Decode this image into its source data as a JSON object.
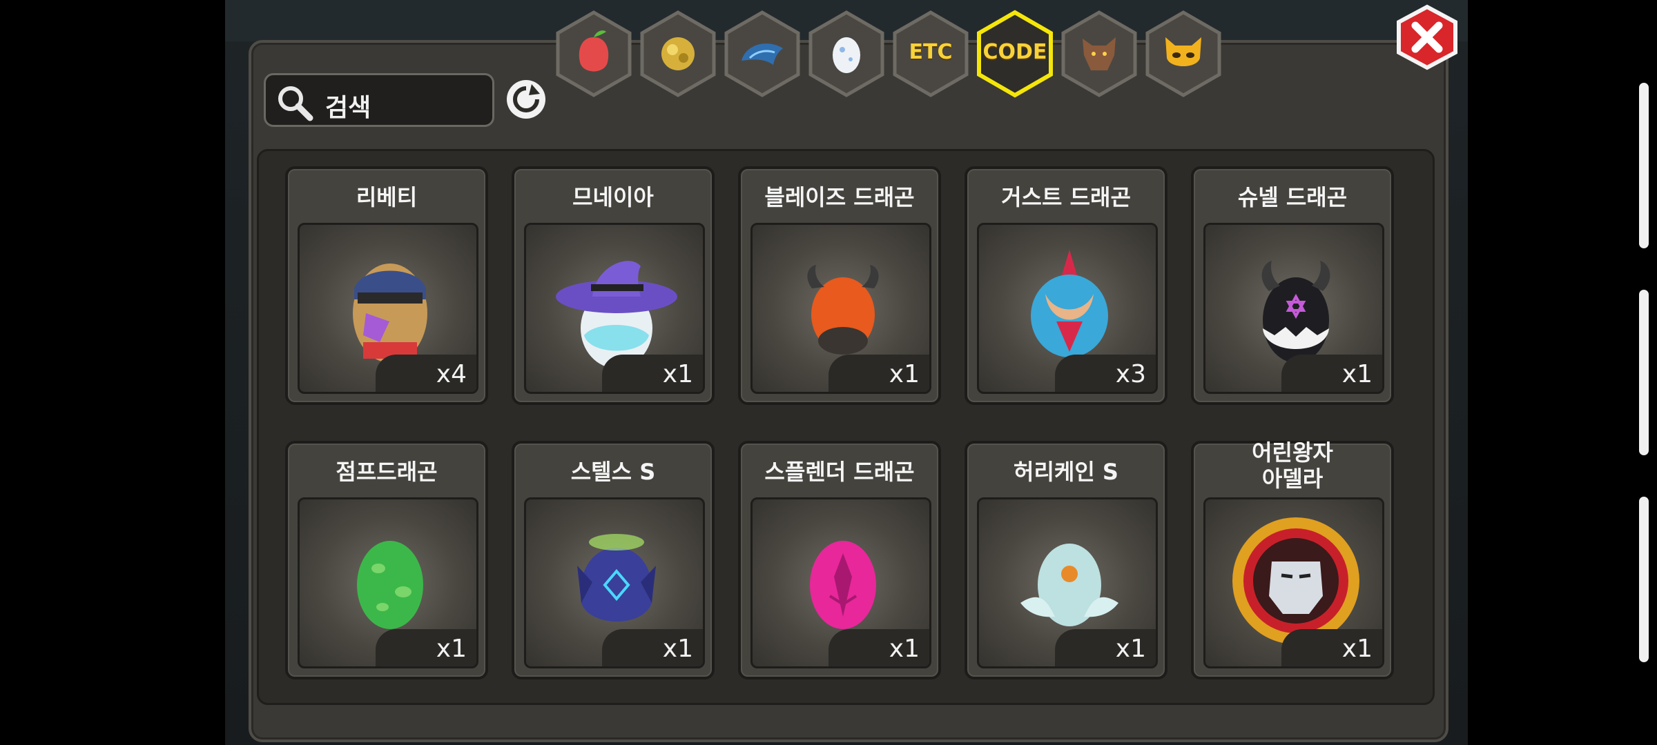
{
  "search": {
    "placeholder": "검색"
  },
  "tabs": [
    {
      "icon": "fruit-icon",
      "label": ""
    },
    {
      "icon": "gold-ore-icon",
      "label": ""
    },
    {
      "icon": "dragon-scale-icon",
      "label": ""
    },
    {
      "icon": "egg-icon",
      "label": ""
    },
    {
      "icon": "etc-icon",
      "label": "ETC"
    },
    {
      "icon": "code-icon",
      "label": "CODE",
      "selected": true
    },
    {
      "icon": "wolf-icon",
      "label": ""
    },
    {
      "icon": "demon-mask-icon",
      "label": ""
    }
  ],
  "items": [
    {
      "name": "리베티",
      "count": "x4",
      "icon": "liberty-egg-icon"
    },
    {
      "name": "므네이아",
      "count": "x1",
      "icon": "mneia-egg-icon"
    },
    {
      "name": "블레이즈 드래곤",
      "count": "x1",
      "icon": "blaze-dragon-egg-icon"
    },
    {
      "name": "거스트 드래곤",
      "count": "x3",
      "icon": "gust-dragon-egg-icon"
    },
    {
      "name": "슈넬 드래곤",
      "count": "x1",
      "icon": "schnell-dragon-egg-icon"
    },
    {
      "name": "점프드래곤",
      "count": "x1",
      "icon": "jump-dragon-egg-icon"
    },
    {
      "name": "스텔스 S",
      "count": "x1",
      "icon": "stealth-s-egg-icon"
    },
    {
      "name": "스플렌더 드래곤",
      "count": "x1",
      "icon": "splendor-dragon-egg-icon"
    },
    {
      "name": "허리케인 S",
      "count": "x1",
      "icon": "hurricane-s-egg-icon"
    },
    {
      "name": "어린왕자\n아델라",
      "count": "x1",
      "icon": "little-prince-adela-icon"
    }
  ],
  "colors": {
    "selected_tab_border": "#f5e60a",
    "close_button": "#d8262b",
    "panel": "#3a3935",
    "inner": "#2c2b28"
  }
}
